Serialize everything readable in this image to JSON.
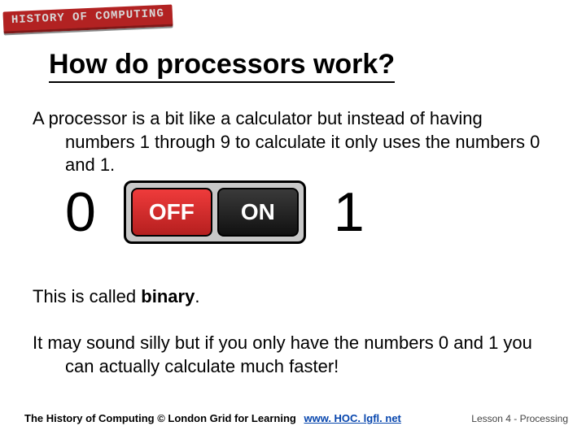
{
  "logo": "HISTORY OF COMPUTING",
  "title": "How do processors work?",
  "intro": "A processor is a bit like a calculator but instead of having numbers 1 through 9 to calculate it only uses the numbers 0 and 1.",
  "digit_left": "0",
  "digit_right": "1",
  "switch": {
    "off": "OFF",
    "on": "ON"
  },
  "called_prefix": "This is called ",
  "called_bold": "binary",
  "called_suffix": ".",
  "silly": "It may sound silly but if you only have the numbers 0 and 1 you can actually calculate much faster!",
  "footer": {
    "credit": "The History of Computing © London Grid for Learning",
    "link_text": "www. HOC. lgfl. net",
    "lesson": "Lesson 4 - Processing"
  }
}
